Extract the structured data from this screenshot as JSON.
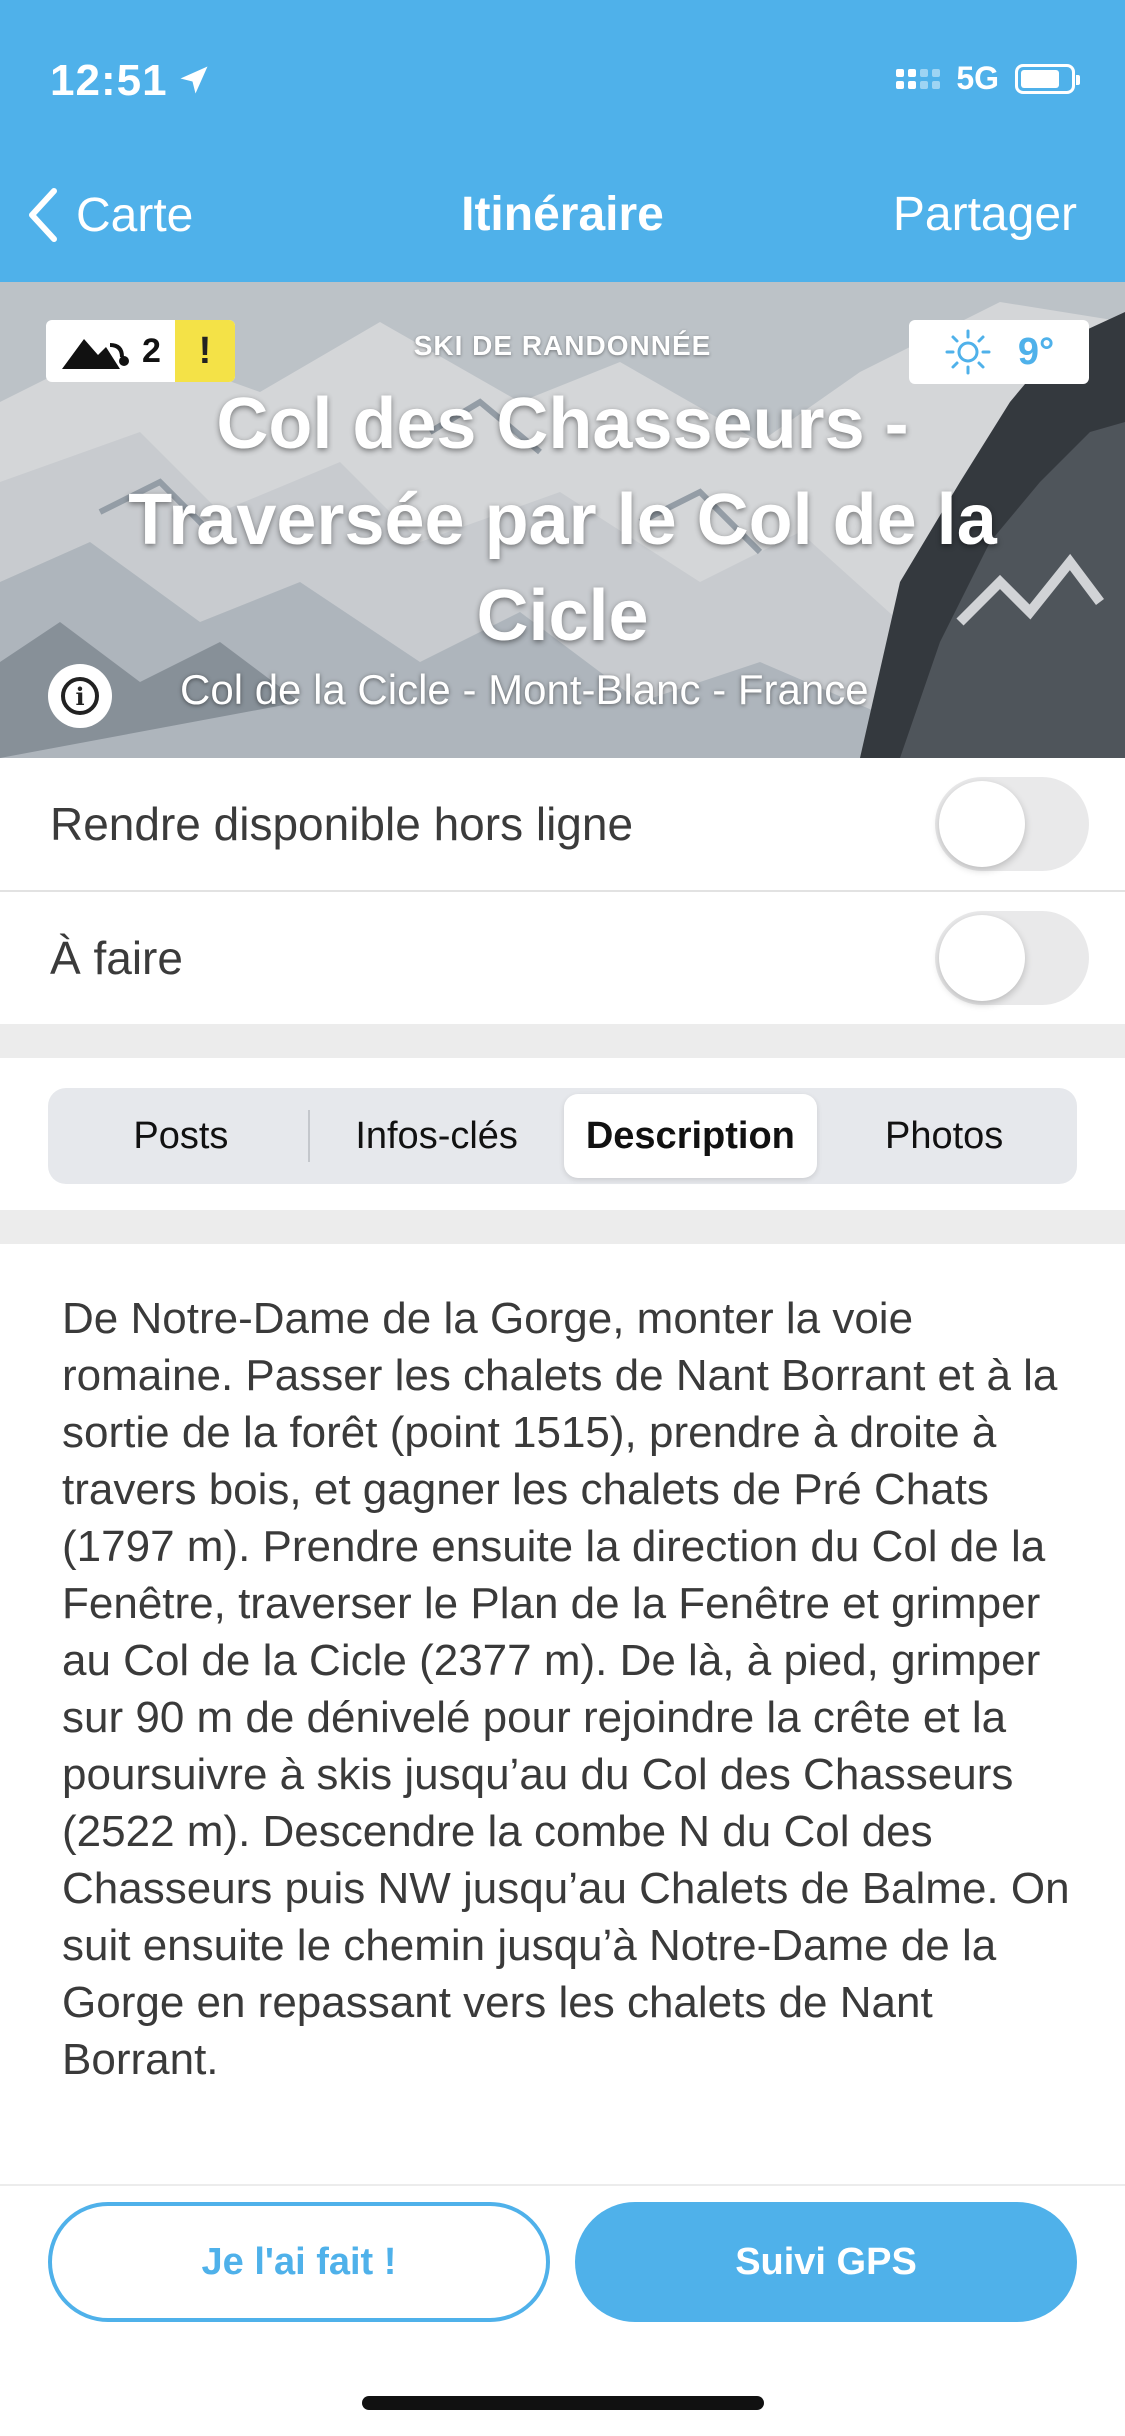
{
  "status": {
    "time": "12:51",
    "network": "5G"
  },
  "nav": {
    "back_label": "Carte",
    "title": "Itinéraire",
    "share_label": "Partager"
  },
  "hero": {
    "risk_level": "2",
    "warning_symbol": "!",
    "activity": "SKI DE RANDONNÉE",
    "temperature": "9°",
    "title": "Col des Chasseurs - Traversée par le Col de la Cicle",
    "location": "Col de la Cicle - Mont-Blanc - France"
  },
  "settings": {
    "offline_label": "Rendre disponible hors ligne",
    "offline_on": false,
    "todo_label": "À faire",
    "todo_on": false
  },
  "tabs": [
    {
      "label": "Posts",
      "active": false
    },
    {
      "label": "Infos-clés",
      "active": false
    },
    {
      "label": "Description",
      "active": true
    },
    {
      "label": "Photos",
      "active": false
    }
  ],
  "description": "De Notre-Dame de la Gorge, monter la voie romaine. Passer les chalets de Nant Borrant et à la sortie de la forêt (point 1515), prendre à droite à travers bois, et gagner les chalets de Pré Chats (1797 m). Prendre ensuite la direction du Col de la Fenêtre, traverser le Plan de la Fenêtre et grimper au Col de la Cicle (2377 m). De là, à pied, grimper sur 90 m de dénivelé pour rejoindre la crête et la poursuivre à skis jusqu’au du Col des Chasseurs (2522 m). Descendre la combe N du Col des Chasseurs puis NW jusqu’au Chalets de Balme. On suit ensuite le chemin jusqu’à Notre-Dame de la Gorge en repassant vers les chalets de Nant Borrant.",
  "actions": {
    "done_label": "Je l'ai fait !",
    "gps_label": "Suivi GPS"
  },
  "colors": {
    "accent": "#4fb1ea",
    "warning": "#f4e247"
  },
  "icons": [
    "location-arrow-icon",
    "signal-icon",
    "battery-icon",
    "chevron-left-icon",
    "avalanche-risk-icon",
    "sun-icon",
    "info-icon"
  ]
}
